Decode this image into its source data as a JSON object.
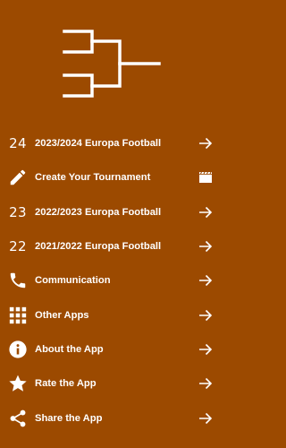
{
  "theme": {
    "background": "#9c4a00",
    "foreground": "#ffffff"
  },
  "logo": {
    "icon": "tournament-bracket-icon"
  },
  "menu": {
    "items": [
      {
        "lead_text": "24",
        "label": "2023/2024 Europa Football",
        "trail_icon": "arrow-right-icon"
      },
      {
        "lead_icon": "pencil-icon",
        "label": "Create Your Tournament",
        "trail_icon": "clapperboard-icon"
      },
      {
        "lead_text": "23",
        "label": "2022/2023 Europa Football",
        "trail_icon": "arrow-right-icon"
      },
      {
        "lead_text": "22",
        "label": "2021/2022 Europa Football",
        "trail_icon": "arrow-right-icon"
      },
      {
        "lead_icon": "phone-icon",
        "label": "Communication",
        "trail_icon": "arrow-right-icon"
      },
      {
        "lead_icon": "grid-icon",
        "label": "Other Apps",
        "trail_icon": "arrow-right-icon"
      },
      {
        "lead_icon": "info-icon",
        "label": "About the App",
        "trail_icon": "arrow-right-icon"
      },
      {
        "lead_icon": "star-icon",
        "label": "Rate the App",
        "trail_icon": "arrow-right-icon"
      },
      {
        "lead_icon": "share-icon",
        "label": "Share the App",
        "trail_icon": "arrow-right-icon"
      }
    ]
  }
}
